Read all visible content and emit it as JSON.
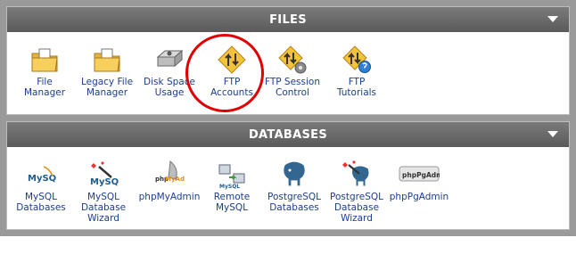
{
  "files": {
    "title": "FILES",
    "items": [
      {
        "label": "File\nManager",
        "icon": "folder-file-manager-icon"
      },
      {
        "label": "Legacy File\nManager",
        "icon": "folder-legacy-icon"
      },
      {
        "label": "Disk Space\nUsage",
        "icon": "disk-drive-icon"
      },
      {
        "label": "FTP\nAccounts",
        "icon": "ftp-accounts-icon"
      },
      {
        "label": "FTP Session\nControl",
        "icon": "ftp-session-icon"
      },
      {
        "label": "FTP\nTutorials",
        "icon": "ftp-tutorials-icon"
      }
    ]
  },
  "databases": {
    "title": "DATABASES",
    "items": [
      {
        "label": "MySQL\nDatabases",
        "icon": "mysql-logo-icon"
      },
      {
        "label": "MySQL\nDatabase\nWizard",
        "icon": "mysql-wizard-icon"
      },
      {
        "label": "phpMyAdmin",
        "icon": "phpmyadmin-logo-icon"
      },
      {
        "label": "Remote\nMySQL",
        "icon": "remote-mysql-icon"
      },
      {
        "label": "PostgreSQL\nDatabases",
        "icon": "postgresql-elephant-icon"
      },
      {
        "label": "PostgreSQL\nDatabase\nWizard",
        "icon": "postgresql-wizard-icon"
      },
      {
        "label": "phpPgAdmin",
        "icon": "phppgadmin-logo-icon"
      }
    ]
  },
  "logo_text": {
    "mysql": "MySQL",
    "phpmyadmin_php": "php",
    "phpmyadmin_my": "MyAdmin",
    "phppgadmin": "phpPgAdmin"
  },
  "colors": {
    "link": "#1b3e8c",
    "header": "#6a6a6a",
    "highlight_circle": "#e00000"
  }
}
